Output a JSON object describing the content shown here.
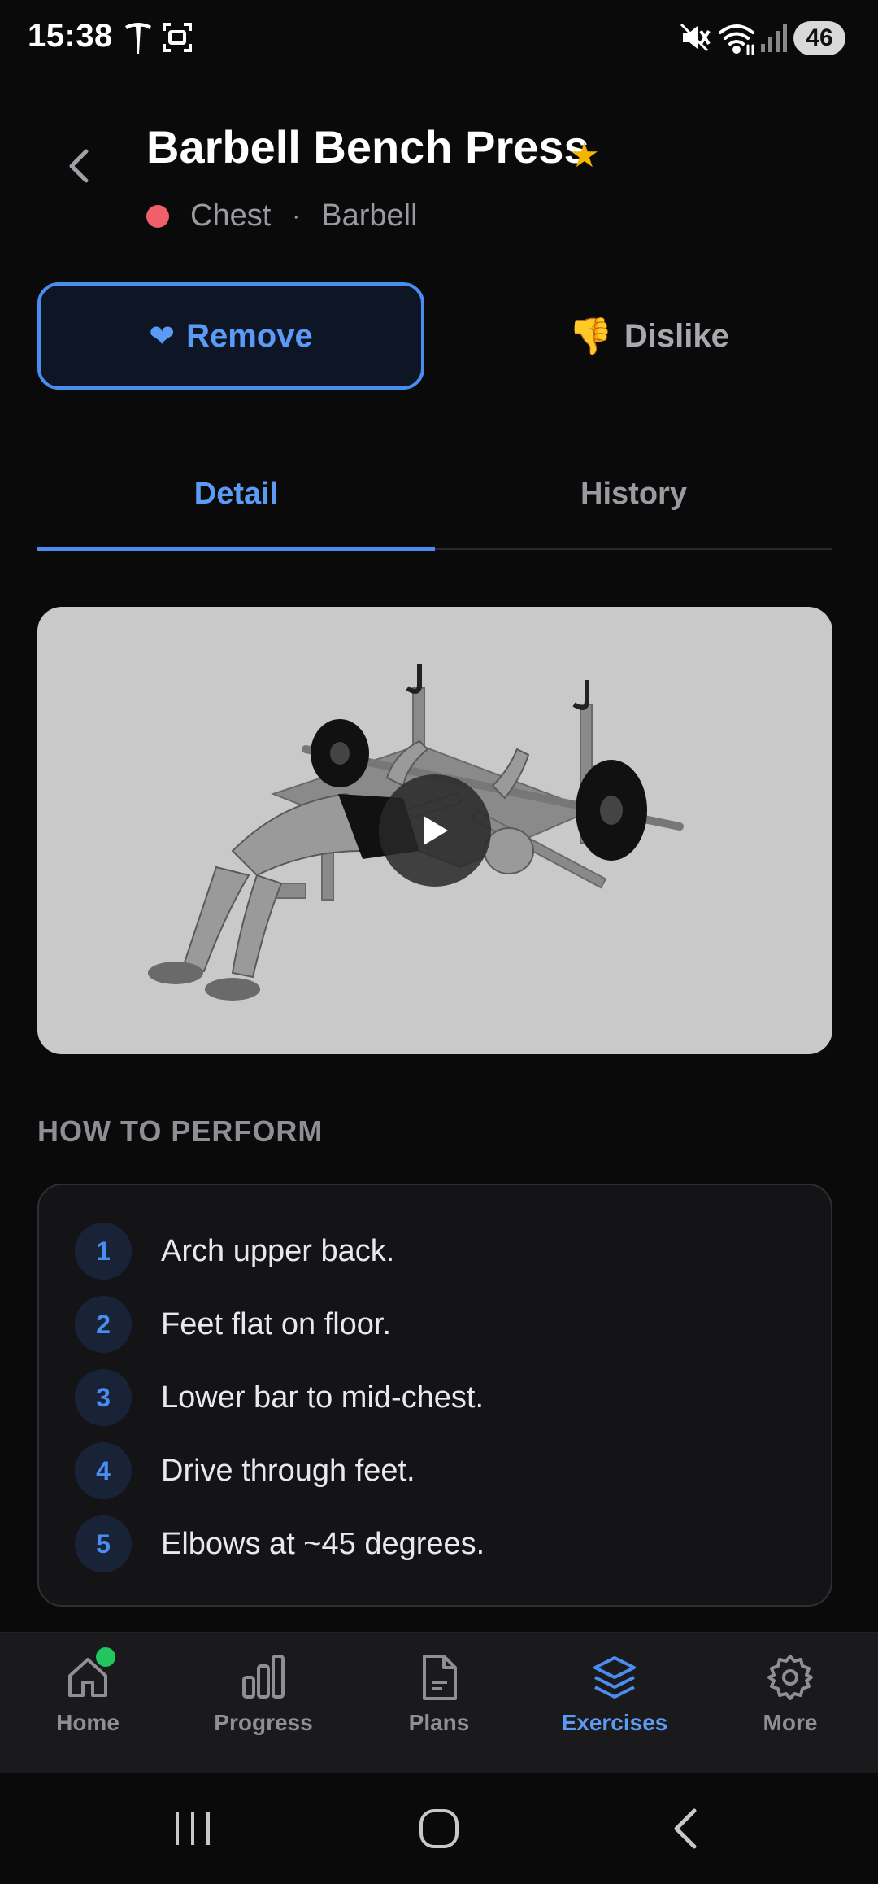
{
  "status_bar": {
    "time": "15:38",
    "battery": "46",
    "icons": [
      "tesla-icon",
      "screenshot-icon",
      "mute-icon",
      "wifi-icon",
      "signal-icon"
    ]
  },
  "header": {
    "title": "Barbell Bench Press",
    "favorite_icon": "star-icon",
    "muscle": "Chest",
    "separator": "·",
    "equipment": "Barbell",
    "muscle_color": "#f0606a"
  },
  "actions": {
    "remove_label": "Remove",
    "dislike_label": "Dislike"
  },
  "tabs": [
    {
      "label": "Detail",
      "active": true
    },
    {
      "label": "History",
      "active": false
    }
  ],
  "section": {
    "title": "HOW TO PERFORM"
  },
  "steps": [
    {
      "num": "1",
      "text": "Arch upper back."
    },
    {
      "num": "2",
      "text": "Feet flat on floor."
    },
    {
      "num": "3",
      "text": "Lower bar to mid-chest."
    },
    {
      "num": "4",
      "text": "Drive through feet."
    },
    {
      "num": "5",
      "text": "Elbows at ~45 degrees."
    }
  ],
  "bottom_nav": [
    {
      "label": "Home",
      "icon": "home-icon",
      "active": false
    },
    {
      "label": "Progress",
      "icon": "bar-chart-icon",
      "active": false
    },
    {
      "label": "Plans",
      "icon": "document-icon",
      "active": false
    },
    {
      "label": "Exercises",
      "icon": "layers-icon",
      "active": true
    },
    {
      "label": "More",
      "icon": "gear-icon",
      "active": false
    }
  ],
  "colors": {
    "accent": "#4a8cf0",
    "background": "#0a0a0b",
    "star": "#f5b400",
    "notification_dot": "#22c55e"
  }
}
